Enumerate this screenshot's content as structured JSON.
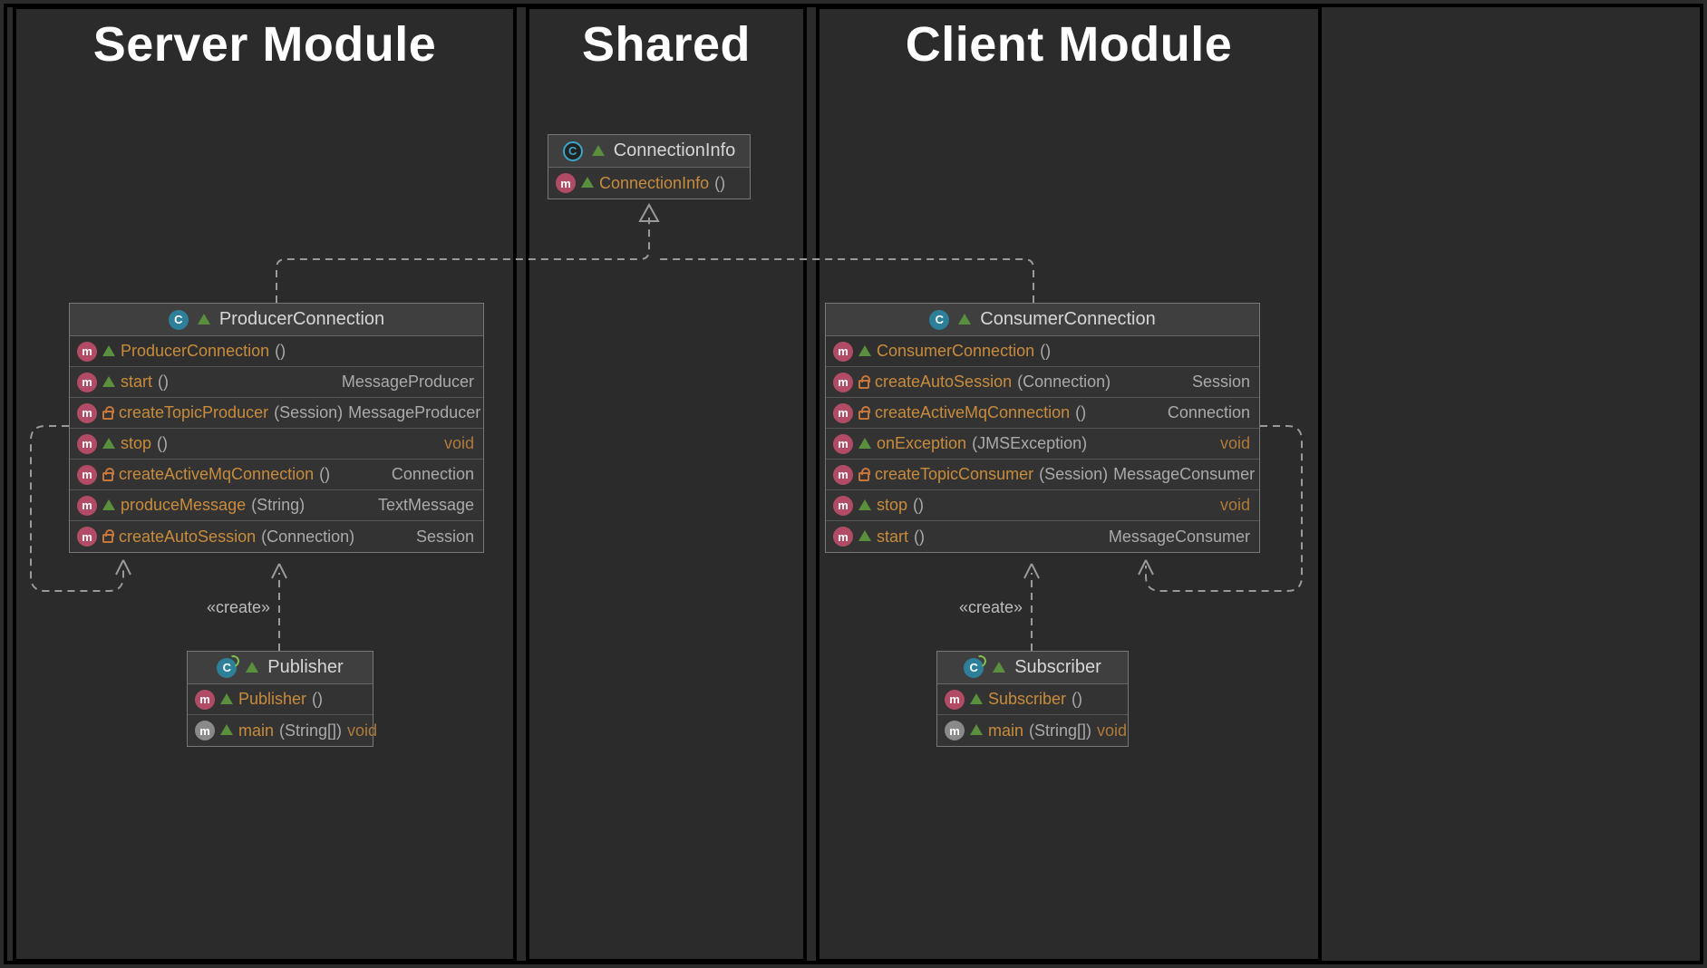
{
  "columns": {
    "server": "Server Module",
    "shared": "Shared",
    "client": "Client Module"
  },
  "stereotypes": {
    "createLeft": "«create»",
    "createRight": "«create»"
  },
  "classes": {
    "connectionInfo": {
      "name": "ConnectionInfo",
      "ctor": {
        "name": "ConnectionInfo",
        "params": "()"
      }
    },
    "producerConnection": {
      "name": "ProducerConnection",
      "ctor": {
        "name": "ProducerConnection",
        "params": "()"
      },
      "m1": {
        "name": "start",
        "params": "()",
        "ret": "MessageProducer"
      },
      "m2": {
        "name": "createTopicProducer",
        "params": "(Session)",
        "ret": "MessageProducer"
      },
      "m3": {
        "name": "stop",
        "params": "()",
        "ret": "void"
      },
      "m4": {
        "name": "createActiveMqConnection",
        "params": "()",
        "ret": "Connection"
      },
      "m5": {
        "name": "produceMessage",
        "params": "(String)",
        "ret": "TextMessage"
      },
      "m6": {
        "name": "createAutoSession",
        "params": "(Connection)",
        "ret": "Session"
      }
    },
    "consumerConnection": {
      "name": "ConsumerConnection",
      "ctor": {
        "name": "ConsumerConnection",
        "params": "()"
      },
      "m1": {
        "name": "createAutoSession",
        "params": "(Connection)",
        "ret": "Session"
      },
      "m2": {
        "name": "createActiveMqConnection",
        "params": "()",
        "ret": "Connection"
      },
      "m3": {
        "name": "onException",
        "params": "(JMSException)",
        "ret": "void"
      },
      "m4": {
        "name": "createTopicConsumer",
        "params": "(Session)",
        "ret": "MessageConsumer"
      },
      "m5": {
        "name": "stop",
        "params": "()",
        "ret": "void"
      },
      "m6": {
        "name": "start",
        "params": "()",
        "ret": "MessageConsumer"
      }
    },
    "publisher": {
      "name": "Publisher",
      "ctor": {
        "name": "Publisher",
        "params": "()"
      },
      "main": {
        "name": "main",
        "params": "(String[])",
        "ret": "void"
      }
    },
    "subscriber": {
      "name": "Subscriber",
      "ctor": {
        "name": "Subscriber",
        "params": "()"
      },
      "main": {
        "name": "main",
        "params": "(String[])",
        "ret": "void"
      }
    }
  }
}
